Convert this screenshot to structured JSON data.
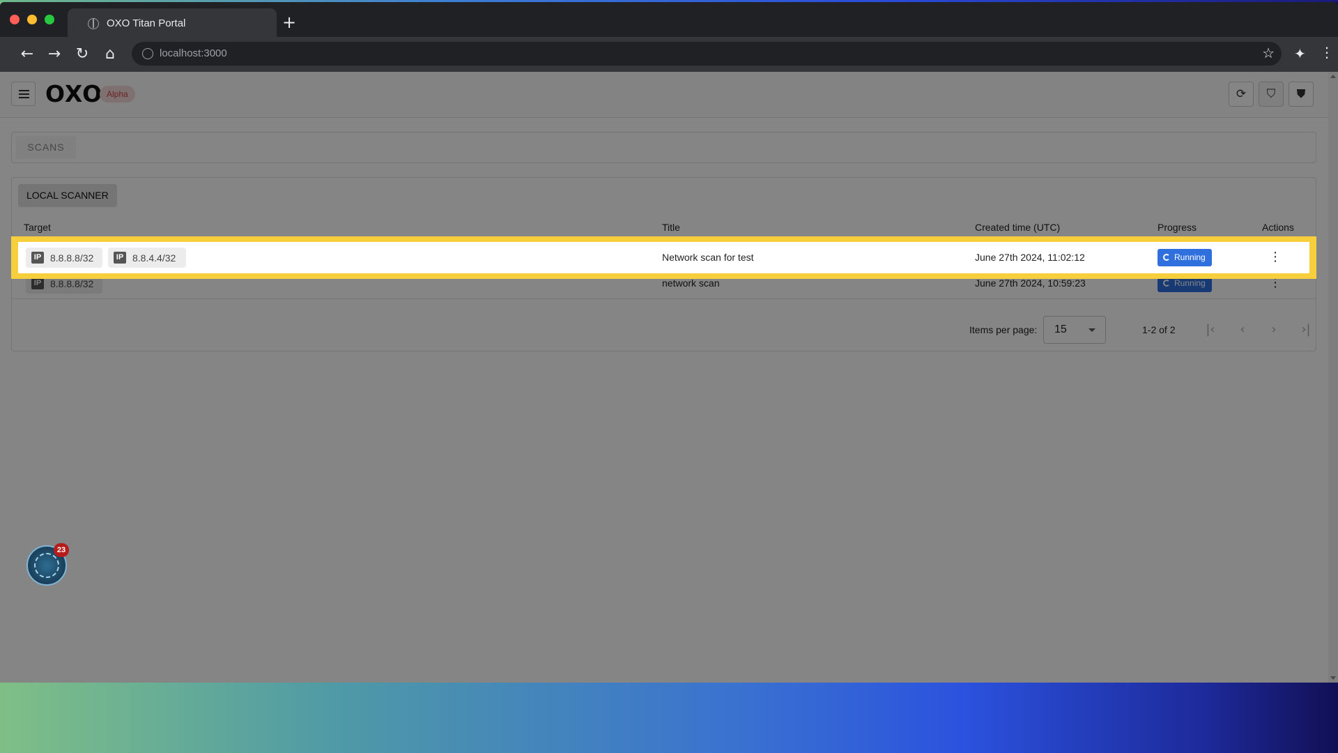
{
  "browser": {
    "tab_title": "OXO Titan Portal",
    "new_tab_symbol": "+",
    "url": "localhost:3000"
  },
  "app": {
    "logo": "OXO",
    "badge": "Alpha"
  },
  "nav": {
    "scans_tab": "SCANS"
  },
  "panel": {
    "scanner_label": "LOCAL SCANNER",
    "columns": [
      "Target",
      "Title",
      "Created time (UTC)",
      "Progress",
      "Actions"
    ],
    "rows": [
      {
        "targets": [
          {
            "type": "IP",
            "value": "8.8.8.8/32"
          },
          {
            "type": "IP",
            "value": "8.8.4.4/32"
          }
        ],
        "title": "Network scan for test",
        "created": "June 27th 2024, 11:02:12",
        "progress": "Running"
      },
      {
        "targets": [
          {
            "type": "IP",
            "value": "8.8.8.8/32"
          }
        ],
        "title": "network scan",
        "created": "June 27th 2024, 10:59:23",
        "progress": "Running"
      }
    ]
  },
  "pagination": {
    "items_per_page_label": "Items per page:",
    "items_per_page_value": "15",
    "range": "1-2 of 2"
  },
  "notification": {
    "count": "23"
  },
  "colors": {
    "running_badge": "#2f6fde",
    "highlight": "#f7cf3c",
    "alpha_badge_text": "#cc4444"
  }
}
